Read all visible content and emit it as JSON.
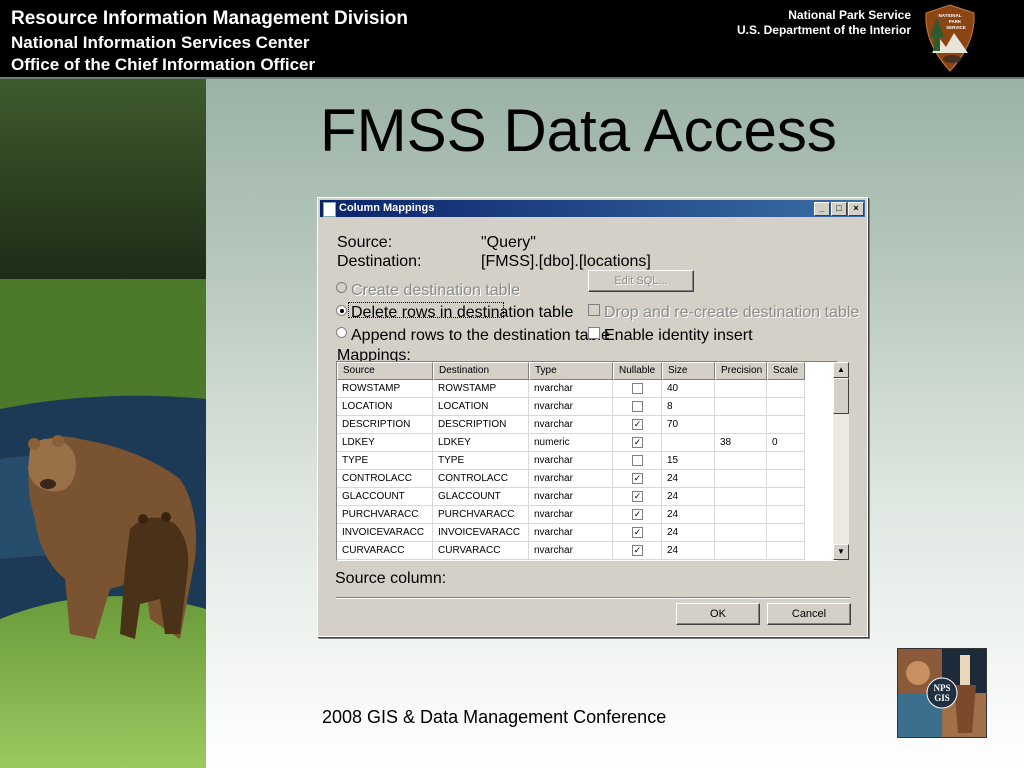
{
  "header": {
    "line1": "Resource Information Management Division",
    "line2": "National Information Services Center",
    "line3": "Office of the Chief Information Officer",
    "agency": "National Park Service",
    "department": "U.S. Department of the Interior",
    "logo_text": [
      "NATIONAL",
      "PARK",
      "SERVICE"
    ]
  },
  "slide": {
    "title": "FMSS Data Access",
    "footer": "2008 GIS & Data Management Conference",
    "gis_logo_text": [
      "NPS",
      "GIS"
    ]
  },
  "dialog": {
    "title": "Column Mappings",
    "source_label": "Source:",
    "source_value": "\"Query\"",
    "destination_label": "Destination:",
    "destination_value": "[FMSS].[dbo].[locations]",
    "options": {
      "create": "Create destination table",
      "delete": "Delete rows in destination table",
      "append": "Append rows to the destination table",
      "selected": "delete"
    },
    "edit_sql": "Edit SQL...",
    "drop_recreate": "Drop and re-create destination table",
    "enable_identity": "Enable identity insert",
    "mappings_label": "Mappings:",
    "columns": [
      "Source",
      "Destination",
      "Type",
      "Nullable",
      "Size",
      "Precision",
      "Scale"
    ],
    "rows": [
      {
        "source": "ROWSTAMP",
        "destination": "ROWSTAMP",
        "type": "nvarchar",
        "nullable": false,
        "size": "40",
        "precision": "",
        "scale": ""
      },
      {
        "source": "LOCATION",
        "destination": "LOCATION",
        "type": "nvarchar",
        "nullable": false,
        "size": "8",
        "precision": "",
        "scale": ""
      },
      {
        "source": "DESCRIPTION",
        "destination": "DESCRIPTION",
        "type": "nvarchar",
        "nullable": true,
        "size": "70",
        "precision": "",
        "scale": ""
      },
      {
        "source": "LDKEY",
        "destination": "LDKEY",
        "type": "numeric",
        "nullable": true,
        "size": "",
        "precision": "38",
        "scale": "0"
      },
      {
        "source": "TYPE",
        "destination": "TYPE",
        "type": "nvarchar",
        "nullable": false,
        "size": "15",
        "precision": "",
        "scale": ""
      },
      {
        "source": "CONTROLACC",
        "destination": "CONTROLACC",
        "type": "nvarchar",
        "nullable": true,
        "size": "24",
        "precision": "",
        "scale": ""
      },
      {
        "source": "GLACCOUNT",
        "destination": "GLACCOUNT",
        "type": "nvarchar",
        "nullable": true,
        "size": "24",
        "precision": "",
        "scale": ""
      },
      {
        "source": "PURCHVARACC",
        "destination": "PURCHVARACC",
        "type": "nvarchar",
        "nullable": true,
        "size": "24",
        "precision": "",
        "scale": ""
      },
      {
        "source": "INVOICEVARACC",
        "destination": "INVOICEVARACC",
        "type": "nvarchar",
        "nullable": true,
        "size": "24",
        "precision": "",
        "scale": ""
      },
      {
        "source": "CURVARACC",
        "destination": "CURVARACC",
        "type": "nvarchar",
        "nullable": true,
        "size": "24",
        "precision": "",
        "scale": ""
      }
    ],
    "source_column_label": "Source column:",
    "ok": "OK",
    "cancel": "Cancel",
    "window_buttons": {
      "min": "_",
      "max": "□",
      "close": "×"
    },
    "checkmark": "✓",
    "scroll_up": "▲",
    "scroll_down": "▼"
  }
}
